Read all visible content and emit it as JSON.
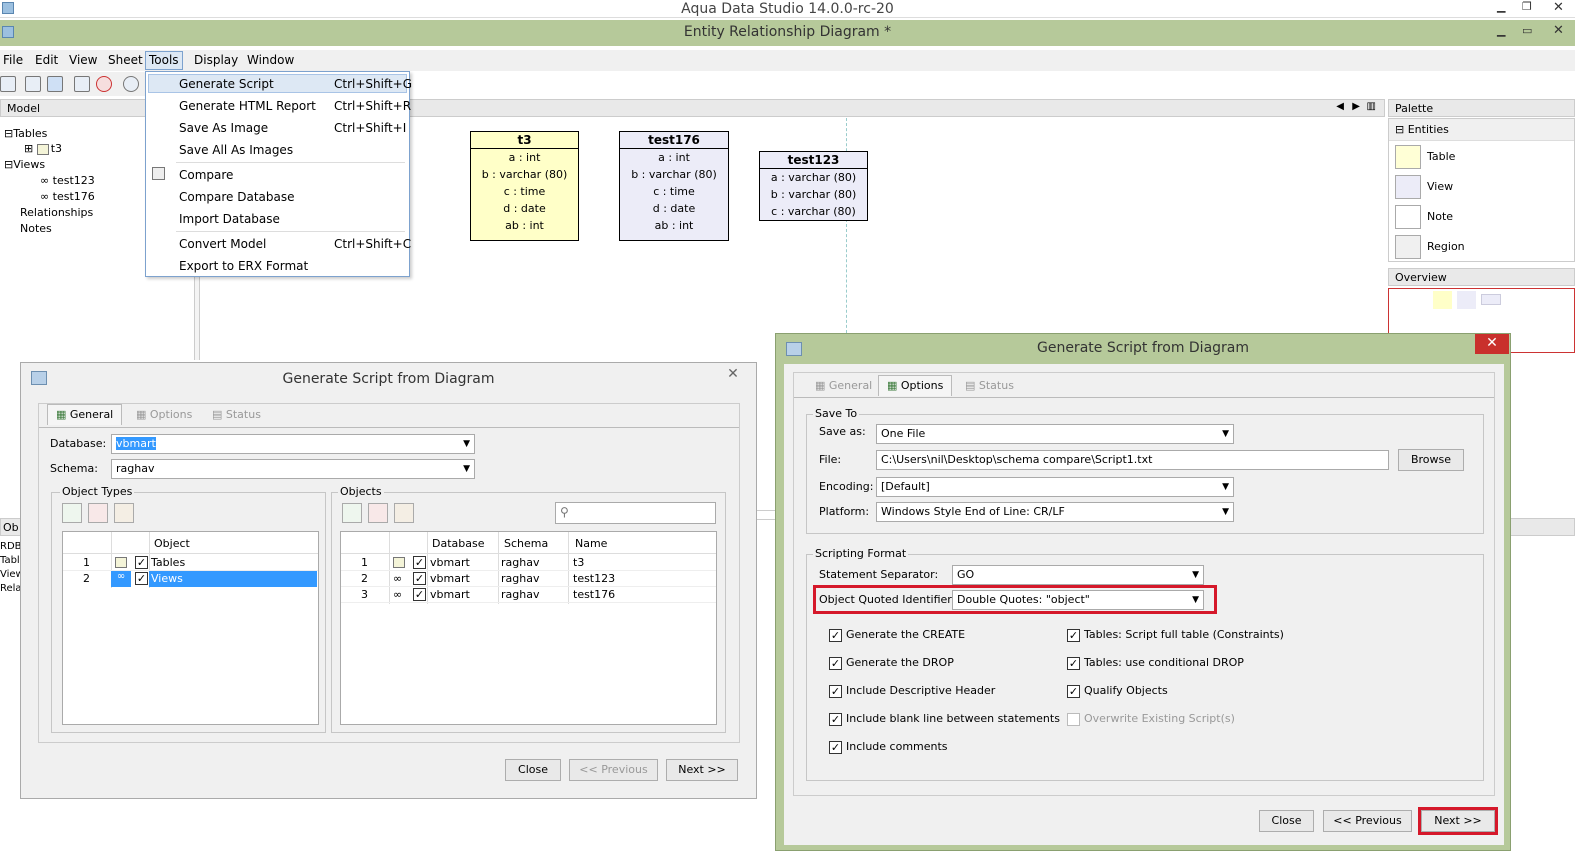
{
  "app": {
    "title": "Aqua Data Studio 14.0.0-rc-20",
    "doc_title": "Entity Relationship Diagram *"
  },
  "menubar": [
    "File",
    "Edit",
    "View",
    "Sheet",
    "Tools",
    "Display",
    "Window"
  ],
  "tools_menu": [
    {
      "label": "Generate Script",
      "shortcut": "Ctrl+Shift+G"
    },
    {
      "label": "Generate HTML Report",
      "shortcut": "Ctrl+Shift+R"
    },
    {
      "label": "Save As Image",
      "shortcut": "Ctrl+Shift+I"
    },
    {
      "label": "Save All As Images",
      "shortcut": ""
    },
    {
      "label": "Compare",
      "shortcut": ""
    },
    {
      "label": "Compare Database",
      "shortcut": ""
    },
    {
      "label": "Import Database",
      "shortcut": ""
    },
    {
      "label": "Convert Model",
      "shortcut": "Ctrl+Shift+C"
    },
    {
      "label": "Export to ERX Format",
      "shortcut": ""
    }
  ],
  "model_panel": {
    "header": "Model",
    "tree": {
      "tables": "Tables",
      "t3": "t3",
      "views": "Views",
      "test123": "test123",
      "test176": "test176",
      "relationships": "Relationships",
      "notes": "Notes"
    }
  },
  "entities": [
    {
      "name": "t3",
      "cols": [
        "a : int",
        "b : varchar (80)",
        "c : time",
        "d : date",
        "ab : int"
      ]
    },
    {
      "name": "test176",
      "cols": [
        "a : int",
        "b : varchar (80)",
        "c : time",
        "d : date",
        "ab : int"
      ]
    },
    {
      "name": "test123",
      "cols": [
        "a : varchar (80)",
        "b : varchar (80)",
        "c : varchar (80)"
      ]
    }
  ],
  "palette": {
    "header": "Palette",
    "section": "Entities",
    "items": [
      "Table",
      "View",
      "Note",
      "Region"
    ],
    "overview": "Overview"
  },
  "bottom_panel": {
    "header": "Ob",
    "lines": [
      "RDBM",
      "Table",
      "Views",
      "Relat"
    ]
  },
  "dialog_left": {
    "title": "Generate Script from Diagram",
    "tabs": [
      "General",
      "Options",
      "Status"
    ],
    "database_label": "Database:",
    "database_value": "vbmart",
    "schema_label": "Schema:",
    "schema_value": "raghav",
    "object_types": {
      "label": "Object Types",
      "col": "Object",
      "rows": [
        {
          "n": "1",
          "name": "Tables"
        },
        {
          "n": "2",
          "name": "Views"
        }
      ]
    },
    "objects": {
      "label": "Objects",
      "cols": [
        "Database",
        "Schema",
        "Name"
      ],
      "rows": [
        {
          "n": "1",
          "db": "vbmart",
          "schema": "raghav",
          "name": "t3"
        },
        {
          "n": "2",
          "db": "vbmart",
          "schema": "raghav",
          "name": "test123"
        },
        {
          "n": "3",
          "db": "vbmart",
          "schema": "raghav",
          "name": "test176"
        }
      ]
    },
    "buttons": {
      "close": "Close",
      "previous": "<< Previous",
      "next": "Next >>"
    }
  },
  "dialog_right": {
    "title": "Generate Script from Diagram",
    "tabs": [
      "General",
      "Options",
      "Status"
    ],
    "save_to": {
      "label": "Save To",
      "save_as_label": "Save as:",
      "save_as": "One File",
      "file_label": "File:",
      "file": "C:\\Users\\nil\\Desktop\\schema compare\\Script1.txt",
      "browse": "Browse",
      "encoding_label": "Encoding:",
      "encoding": "[Default]",
      "platform_label": "Platform:",
      "platform": "Windows Style End of Line: CR/LF"
    },
    "scripting": {
      "label": "Scripting Format",
      "sep_label": "Statement Separator:",
      "sep": "GO",
      "oqi_label": "Object Quoted Identifier:",
      "oqi": "Double Quotes: \"object\""
    },
    "options_left": [
      "Generate the CREATE",
      "Generate the DROP",
      "Include Descriptive Header",
      "Include blank line between statements",
      "Include comments"
    ],
    "options_right": [
      "Tables: Script full table (Constraints)",
      "Tables: use conditional DROP",
      "Qualify Objects",
      "Overwrite Existing Script(s)"
    ],
    "buttons": {
      "close": "Close",
      "previous": "<< Previous",
      "next": "Next >>"
    }
  },
  "colors": {
    "titlebar": "#b6c99a",
    "highlight": "#d5182a",
    "selection": "#3399ff"
  }
}
